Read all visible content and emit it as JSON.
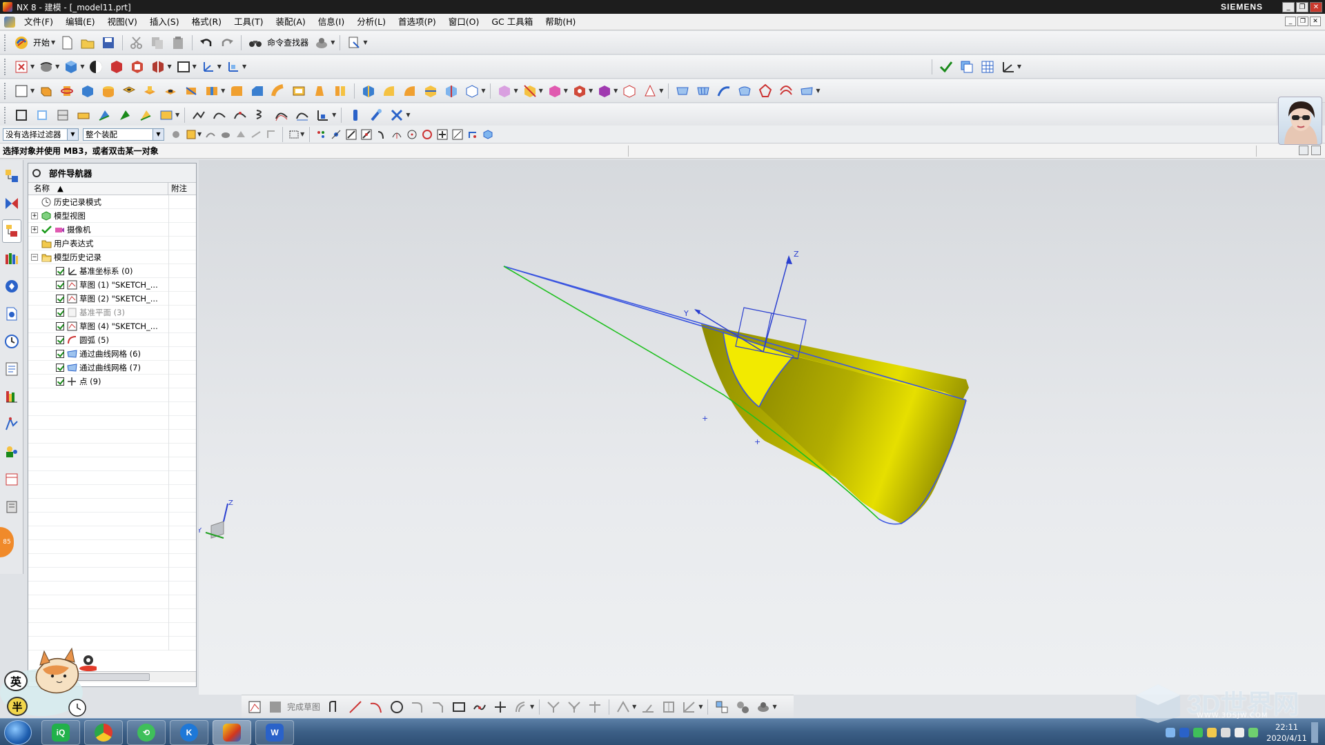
{
  "window": {
    "title": "NX 8 - 建模 - [_model11.prt]",
    "brand": "SIEMENS",
    "controls": [
      "_",
      "❐",
      "✕"
    ]
  },
  "menu": {
    "items": [
      "文件(F)",
      "编辑(E)",
      "视图(V)",
      "插入(S)",
      "格式(R)",
      "工具(T)",
      "装配(A)",
      "信息(I)",
      "分析(L)",
      "首选项(P)",
      "窗口(O)",
      "GC 工具箱",
      "帮助(H)"
    ]
  },
  "toolbar": {
    "start_label": "开始",
    "command_finder_label": "命令查找器"
  },
  "selection": {
    "filter_value": "没有选择过滤器",
    "scope_value": "整个装配"
  },
  "status": {
    "prompt": "选择对象并使用 MB3，或者双击某一对象"
  },
  "navigator": {
    "title": "部件导航器",
    "col_name": "名称",
    "col_note": "附注",
    "items": [
      {
        "label": "历史记录模式"
      },
      {
        "label": "模型视图"
      },
      {
        "label": "摄像机"
      },
      {
        "label": "用户表达式"
      },
      {
        "label": "模型历史记录"
      },
      {
        "label": "基准坐标系 (0)"
      },
      {
        "label": "草图 (1) \"SKETCH_..."
      },
      {
        "label": "草图 (2) \"SKETCH_..."
      },
      {
        "label": "基准平面 (3)"
      },
      {
        "label": "草图 (4) \"SKETCH_..."
      },
      {
        "label": "圆弧 (5)"
      },
      {
        "label": "通过曲线网格 (6)"
      },
      {
        "label": "通过曲线网格 (7)"
      },
      {
        "label": "点 (9)"
      }
    ]
  },
  "viewport": {
    "triad_z": "Z",
    "triad_y": "Y",
    "csys_z": "Z",
    "csys_y": "Y",
    "surface_color": "#c9c400"
  },
  "sketch_toolbar": {
    "finish_label": "完成草图"
  },
  "taskbar": {
    "clock_time": "22:11",
    "clock_date": "2020/4/11"
  },
  "watermark": {
    "title": "3D世界网",
    "url": "WWW.3DSJW.COM"
  },
  "overlays": {
    "ime_label": "英",
    "ime_half": "半",
    "badge": "85"
  },
  "colors": {
    "accent": "#2a62c9",
    "title_bar": "#1d1d1d",
    "surface_yellow": "#e6df00",
    "edge_blue": "#3a55e0",
    "edge_green": "#20c020"
  }
}
